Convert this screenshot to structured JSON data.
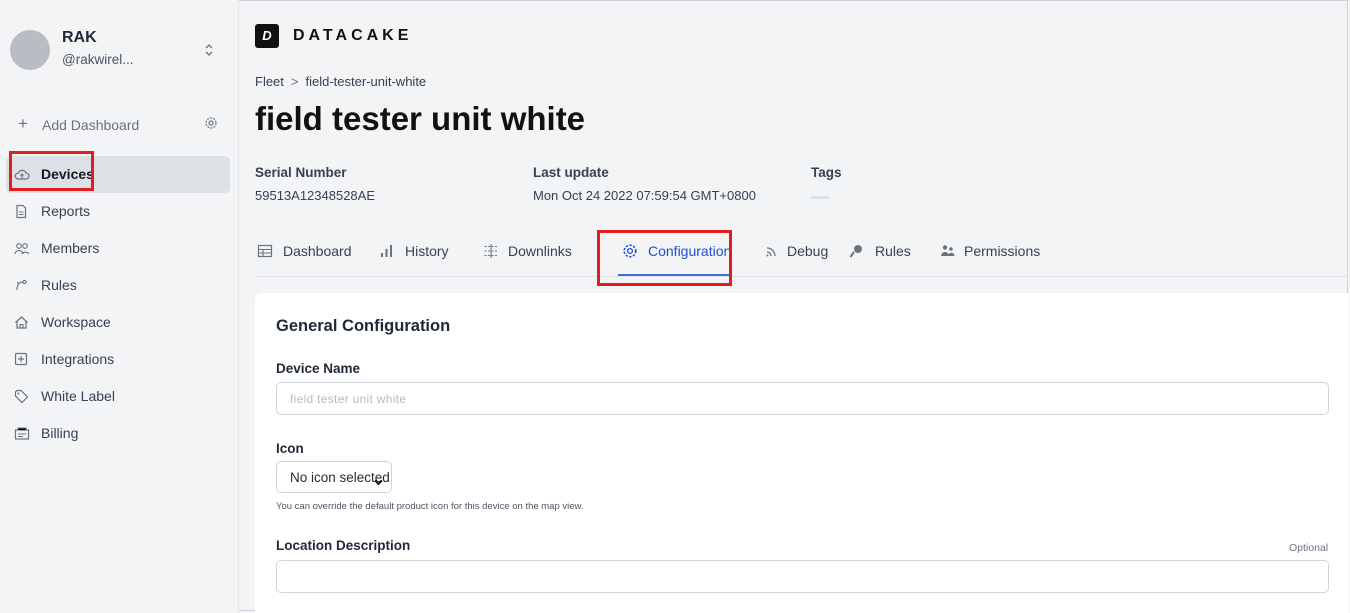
{
  "account": {
    "name": "RAK",
    "handle": "@rakwirel..."
  },
  "sidebar": {
    "add_dashboard": "Add Dashboard",
    "items": [
      {
        "label": "Devices",
        "icon": "cloud-icon",
        "active": true
      },
      {
        "label": "Reports",
        "icon": "document-icon"
      },
      {
        "label": "Members",
        "icon": "users-icon"
      },
      {
        "label": "Rules",
        "icon": "rules-icon"
      },
      {
        "label": "Workspace",
        "icon": "home-icon"
      },
      {
        "label": "Integrations",
        "icon": "plus-square-icon"
      },
      {
        "label": "White Label",
        "icon": "tag-icon"
      },
      {
        "label": "Billing",
        "icon": "billing-icon"
      }
    ]
  },
  "brand": {
    "logo_mark": "D",
    "name": "DATACAKE"
  },
  "breadcrumb": {
    "parent": "Fleet",
    "separator": ">",
    "current": "field-tester-unit-white"
  },
  "device": {
    "title": "field tester unit white",
    "serial_label": "Serial Number",
    "serial_value": "59513A12348528AE",
    "update_label": "Last update",
    "update_value": "Mon Oct 24 2022 07:59:54 GMT+0800",
    "tags_label": "Tags"
  },
  "tabs": [
    {
      "label": "Dashboard",
      "icon": "table-icon"
    },
    {
      "label": "History",
      "icon": "bar-chart-icon"
    },
    {
      "label": "Downlinks",
      "icon": "downlink-icon"
    },
    {
      "label": "Configuration",
      "icon": "gear-icon",
      "active": true
    },
    {
      "label": "Debug",
      "icon": "rss-icon"
    },
    {
      "label": "Rules",
      "icon": "rules-icon"
    },
    {
      "label": "Permissions",
      "icon": "users-icon"
    }
  ],
  "config": {
    "heading": "General Configuration",
    "device_name_label": "Device Name",
    "device_name_value": "field tester unit white",
    "icon_label": "Icon",
    "icon_select": "No icon selected",
    "icon_help": "You can override the default product icon for this device on the map view.",
    "location_label": "Location Description",
    "location_optional": "Optional",
    "location_value": ""
  },
  "colors": {
    "accent": "#1d4ed8",
    "highlight": "#e11d1d",
    "sidebar_bg": "#f3f4f6"
  }
}
